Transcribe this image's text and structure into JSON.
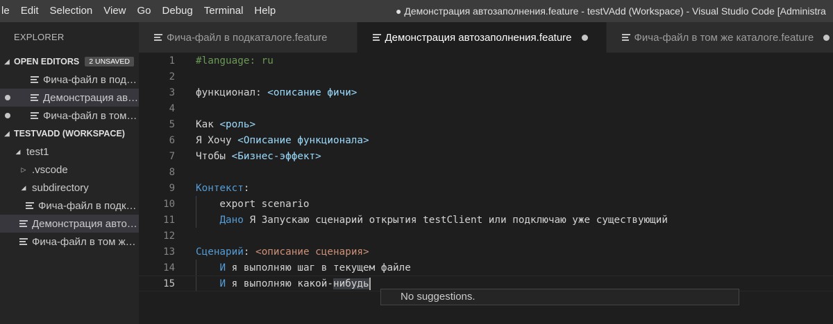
{
  "menu": {
    "items": [
      "le",
      "Edit",
      "Selection",
      "View",
      "Go",
      "Debug",
      "Terminal",
      "Help"
    ]
  },
  "window_title": "● Демонстрация автозаполнения.feature - testVAdd (Workspace) - Visual Studio Code [Administra",
  "sidebar": {
    "title": "EXPLORER",
    "open_editors": {
      "header": "OPEN EDITORS",
      "badge": "2 UNSAVED",
      "items": [
        {
          "label": "Фича-файл в подк…",
          "unsaved": false
        },
        {
          "label": "Демонстрация ав…",
          "unsaved": true
        },
        {
          "label": "Фича-файл в том…",
          "unsaved": true
        }
      ]
    },
    "workspace": {
      "header": "TESTVADD (WORKSPACE)",
      "folder": "test1",
      "children": [
        {
          "label": ".vscode",
          "type": "folder-collapsed"
        },
        {
          "label": "subdirectory",
          "type": "folder-expanded"
        },
        {
          "label": "Фича-файл в подк…",
          "type": "file-nested"
        },
        {
          "label": "Демонстрация авто…",
          "type": "file"
        },
        {
          "label": "Фича-файл в том ж…",
          "type": "file"
        }
      ]
    }
  },
  "tabs": [
    {
      "label": "Фича-файл в подкаталоге.feature",
      "active": false,
      "unsaved": false
    },
    {
      "label": "Демонстрация автозаполнения.feature",
      "active": true,
      "unsaved": true
    },
    {
      "label": "Фича-файл в том же каталоге.feature",
      "active": false,
      "unsaved": true
    }
  ],
  "editor": {
    "lines": [
      {
        "n": "1",
        "tokens": [
          [
            "c-comment",
            "#language: ru"
          ]
        ]
      },
      {
        "n": "2",
        "tokens": []
      },
      {
        "n": "3",
        "tokens": [
          [
            "c-plain",
            "функционал: "
          ],
          [
            "c-ph",
            "<описание фичи>"
          ]
        ]
      },
      {
        "n": "4",
        "tokens": []
      },
      {
        "n": "5",
        "tokens": [
          [
            "c-plain",
            "Как "
          ],
          [
            "c-ph",
            "<роль>"
          ]
        ]
      },
      {
        "n": "6",
        "tokens": [
          [
            "c-plain",
            "Я Хочу "
          ],
          [
            "c-ph",
            "<Описание функционала>"
          ]
        ]
      },
      {
        "n": "7",
        "tokens": [
          [
            "c-plain",
            "Чтобы "
          ],
          [
            "c-ph",
            "<Бизнес-эффект>"
          ]
        ]
      },
      {
        "n": "8",
        "tokens": []
      },
      {
        "n": "9",
        "tokens": [
          [
            "c-kw",
            "Контекст"
          ],
          [
            "c-plain",
            ":"
          ]
        ]
      },
      {
        "n": "10",
        "tokens": [
          [
            "c-plain",
            "    export scenario"
          ]
        ]
      },
      {
        "n": "11",
        "tokens": [
          [
            "c-plain",
            "    "
          ],
          [
            "c-kw",
            "Дано"
          ],
          [
            "c-plain",
            " Я Запускаю сценарий открытия testClient или подключаю уже существующий"
          ]
        ]
      },
      {
        "n": "12",
        "tokens": []
      },
      {
        "n": "13",
        "tokens": [
          [
            "c-kw",
            "Сценарий"
          ],
          [
            "c-plain",
            ": "
          ],
          [
            "c-ph2",
            "<описание сценария>"
          ]
        ]
      },
      {
        "n": "14",
        "tokens": [
          [
            "c-plain",
            "    "
          ],
          [
            "c-kw",
            "И"
          ],
          [
            "c-plain",
            " я выполняю шаг в текущем файле"
          ]
        ]
      },
      {
        "n": "15",
        "tokens": [
          [
            "c-plain",
            "    "
          ],
          [
            "c-kw",
            "И"
          ],
          [
            "c-plain",
            " я выполняю какой-"
          ],
          [
            "word-hl",
            "нибудь"
          ]
        ]
      }
    ],
    "current_line": "15"
  },
  "suggest": {
    "message": "No suggestions."
  }
}
